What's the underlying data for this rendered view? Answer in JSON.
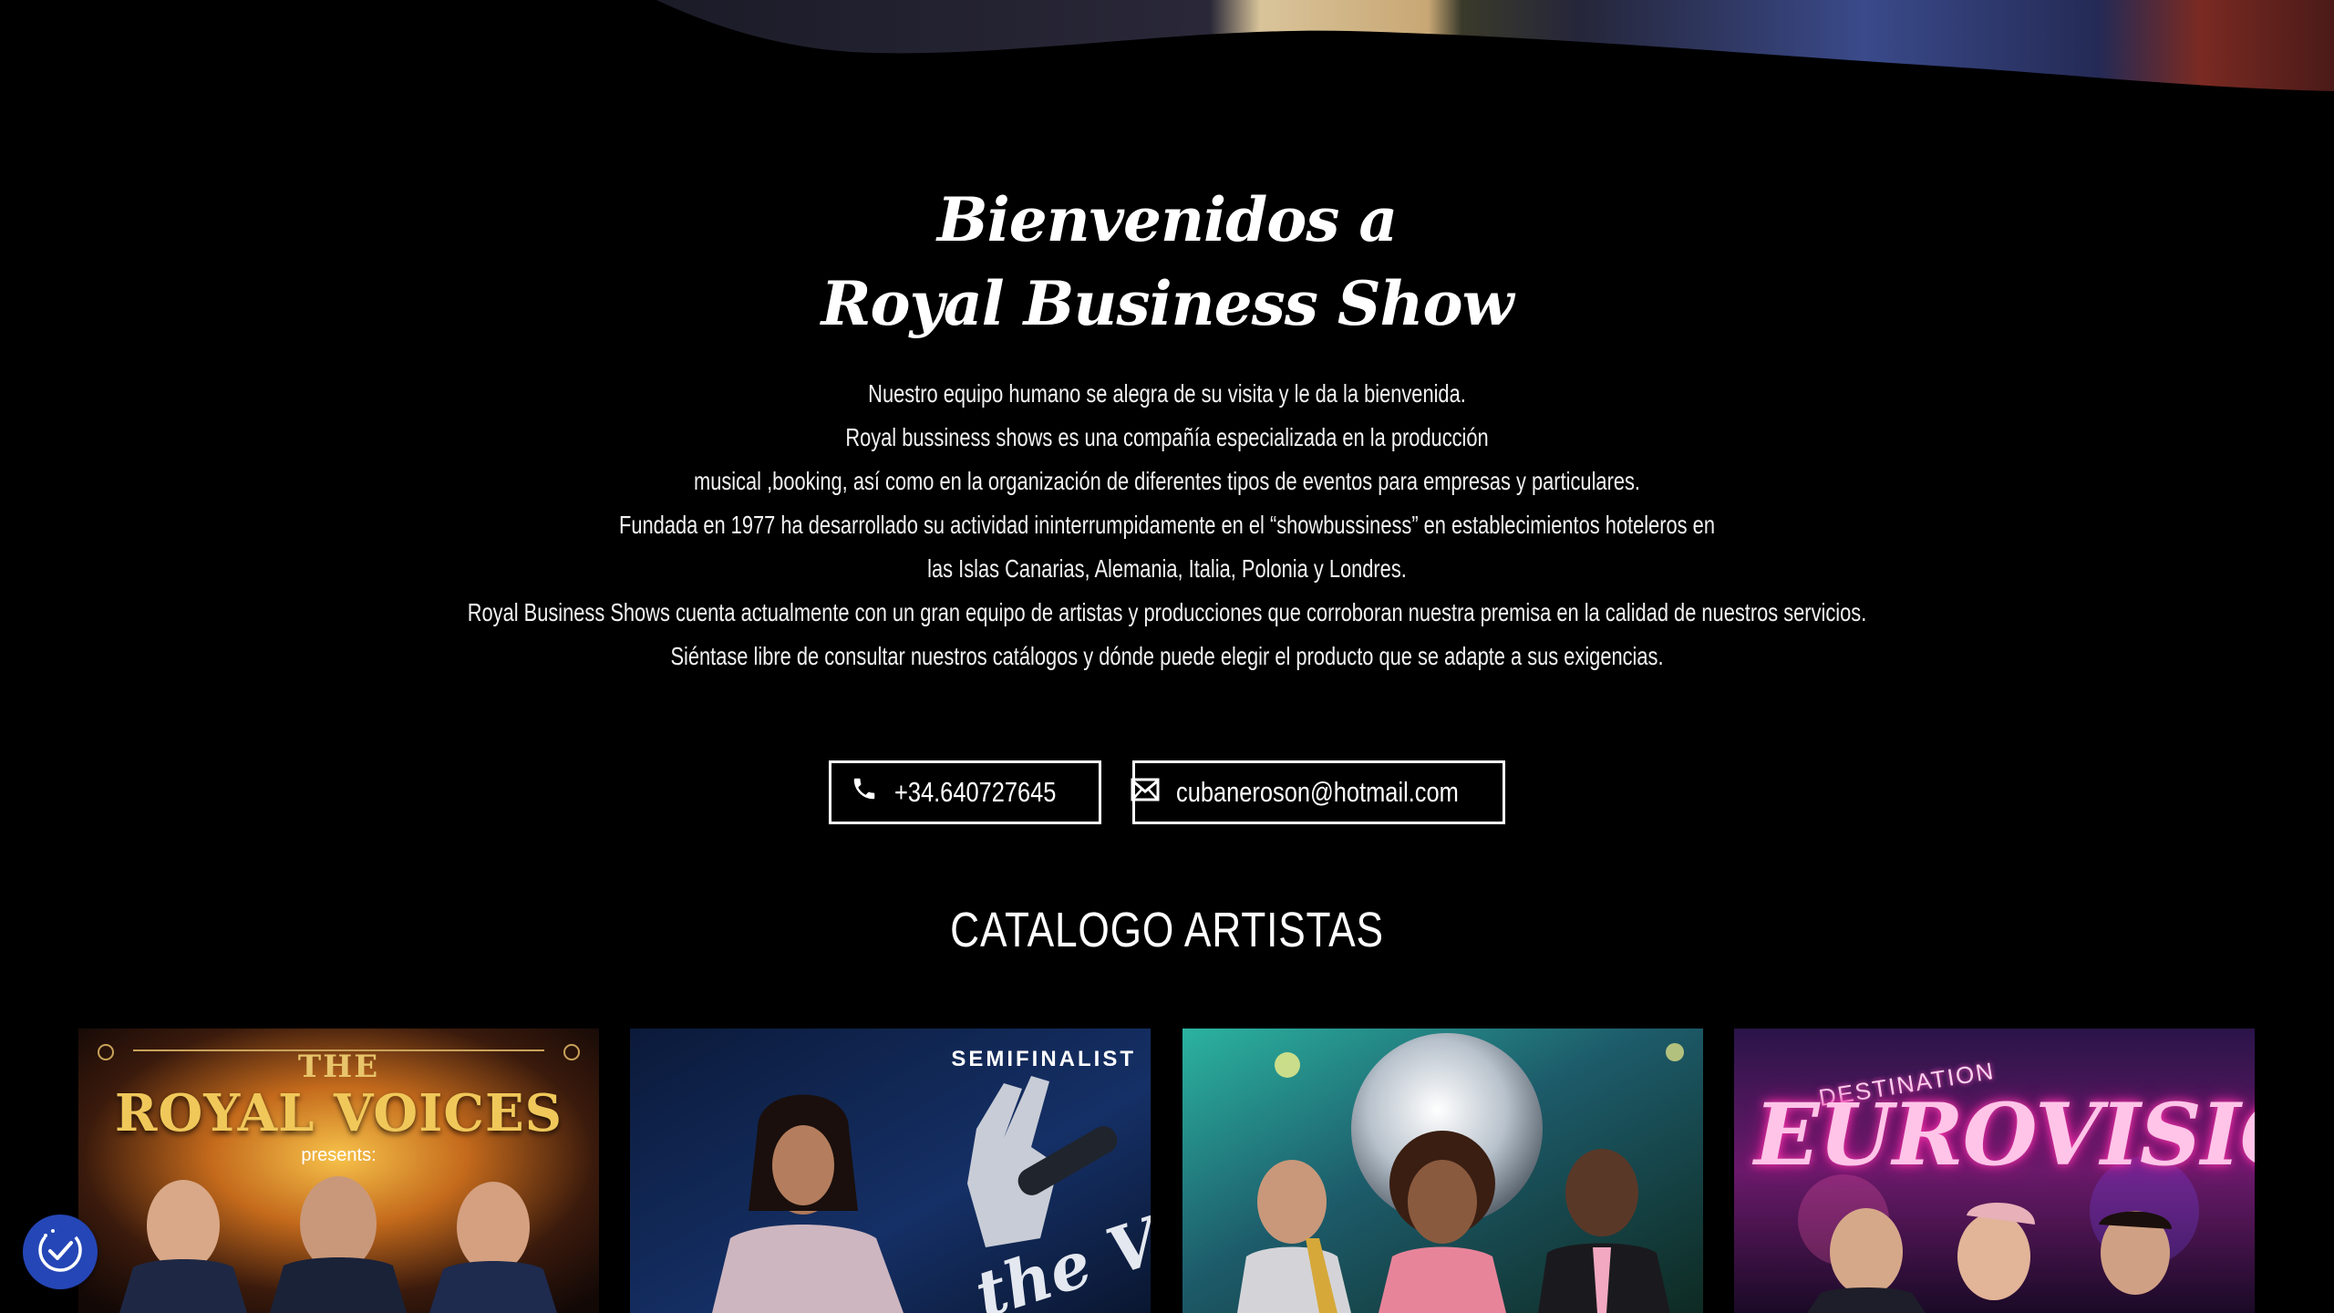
{
  "welcome": {
    "title_line1": "Bienvenidos a",
    "title_line2": "Royal Business Show"
  },
  "intro": {
    "lines": [
      "Nuestro equipo humano se alegra de su visita y le da la bienvenida.",
      "Royal bussiness shows es una compañía especializada en la producción",
      "musical ,booking, así como en la organización de diferentes tipos de eventos para empresas y particulares.",
      "Fundada en 1977 ha desarrollado su actividad ininterrumpidamente en el “showbussiness” en establecimientos hoteleros en",
      "las Islas Canarias, Alemania, Italia, Polonia y Londres.",
      "Royal Business Shows cuenta actualmente con un gran equipo de artistas y producciones que corroboran nuestra premisa en la calidad de nuestros servicios.",
      "Siéntase libre de consultar nuestros catálogos y dónde puede elegir el producto que se adapte a sus exigencias."
    ]
  },
  "contact": {
    "phone": "+34.640727645",
    "email": "cubaneroson@hotmail.com",
    "phone_icon": "phone-icon",
    "email_icon": "mail-icon"
  },
  "catalog": {
    "heading": "CATALOGO ARTISTAS",
    "cards": [
      {
        "the": "THE",
        "title": "ROYAL VOICES",
        "subtitle": "presents:"
      },
      {
        "badge": "SEMIFINALIST",
        "logo_text": "the Voice"
      },
      {},
      {
        "kicker": "DESTINATION",
        "title": "EUROVISION"
      }
    ]
  },
  "accessibility": {
    "icon": "accessibility-icon",
    "color": "#2546b6"
  }
}
